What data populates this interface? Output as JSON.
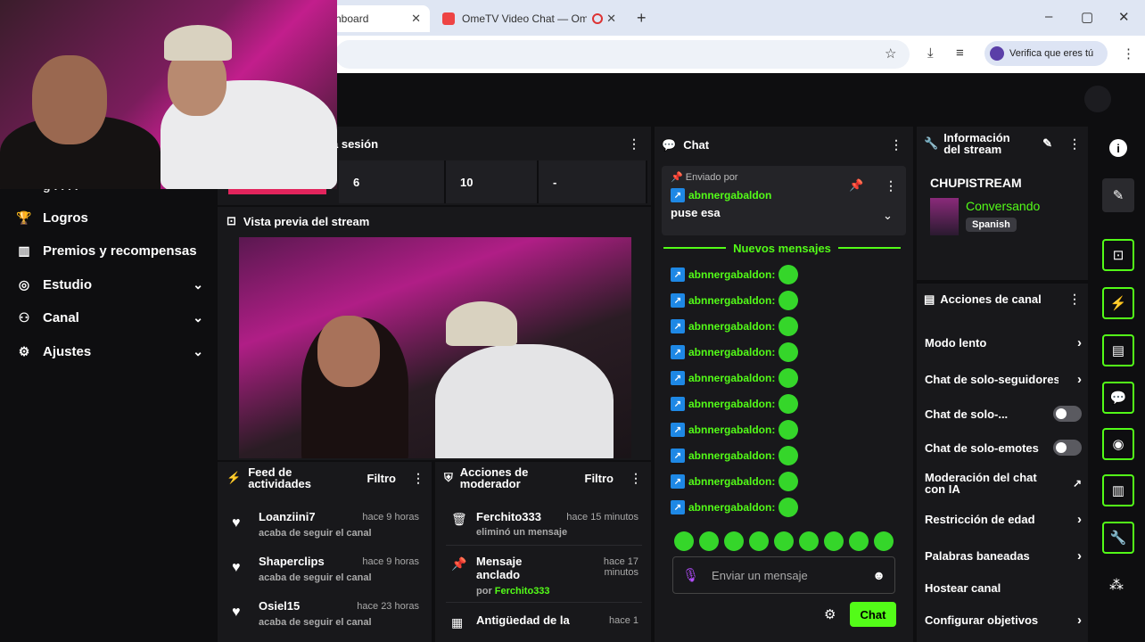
{
  "browser": {
    "tab1_label": "hboard",
    "tab2_label": "OmeTV Video Chat — Ome",
    "new_tab": "+",
    "verify_label": "Verifica que eres tú",
    "window_controls": [
      "–",
      "▢",
      "✕"
    ]
  },
  "sidebar": {
    "truncated_top": "g . . . .",
    "items": [
      {
        "label": "Logros",
        "icon": "trophy-icon",
        "chevron": false
      },
      {
        "label": "Premios y recompensas",
        "icon": "chart-icon",
        "chevron": false
      },
      {
        "label": "Estudio",
        "icon": "studio-icon",
        "chevron": true
      },
      {
        "label": "Canal",
        "icon": "channel-icon",
        "chevron": true
      },
      {
        "label": "Ajustes",
        "icon": "gear-icon",
        "chevron": true
      }
    ]
  },
  "session": {
    "title": "a sesión",
    "stats": [
      "6",
      "10",
      "-"
    ]
  },
  "preview": {
    "title": "Vista previa del stream"
  },
  "activity": {
    "title": "Feed de actividades",
    "filter": "Filtro",
    "items": [
      {
        "name": "Loanziini7",
        "time": "hace 9 horas",
        "sub": "acaba de seguir el canal"
      },
      {
        "name": "Shaperclips",
        "time": "hace 9 horas",
        "sub": "acaba de seguir el canal"
      },
      {
        "name": "Osiel15",
        "time": "hace 23 horas",
        "sub": "acaba de seguir el canal"
      }
    ]
  },
  "mod_actions": {
    "title": "Acciones de moderador",
    "filter": "Filtro",
    "items": [
      {
        "name": "Ferchito333",
        "time": "hace 15 minutos",
        "sub": "eliminó un mensaje"
      },
      {
        "name": "Mensaje anclado",
        "time": "hace 17 minutos",
        "sub_prefix": "por",
        "sub_user": "Ferchito333"
      },
      {
        "name": "Antigüedad de la",
        "time": "hace 1"
      }
    ]
  },
  "chat": {
    "title": "Chat",
    "pinned_label": "Enviado por",
    "pinned_user": "abnnergabaldon",
    "pinned_msg": "puse esa",
    "new_messages": "Nuevos mensajes",
    "message_user": "abnnergabaldon:",
    "message_count": 10,
    "input_placeholder": "Enviar un mensaje",
    "send_label": "Chat"
  },
  "stream_info": {
    "title": "Información del stream",
    "channel": "CHUPISTREAM",
    "category": "Conversando",
    "language": "Spanish"
  },
  "channel_actions": {
    "title": "Acciones de canal",
    "rows": [
      {
        "label": "Modo lento",
        "type": "chevron"
      },
      {
        "label": "Chat de solo-seguidores",
        "type": "chevron"
      },
      {
        "label": "Chat de solo-...",
        "type": "toggle"
      },
      {
        "label": "Chat de solo-emotes",
        "type": "toggle"
      },
      {
        "label": "Moderación del chat con IA",
        "type": "external"
      },
      {
        "label": "Restricción de edad",
        "type": "chevron"
      },
      {
        "label": "Palabras baneadas",
        "type": "chevron"
      },
      {
        "label": "Hostear canal",
        "type": "none"
      },
      {
        "label": "Configurar objetivos",
        "type": "chevron"
      }
    ]
  },
  "colors": {
    "accent": "#53fc18",
    "panel": "#18181b",
    "background": "#0e0e10"
  }
}
